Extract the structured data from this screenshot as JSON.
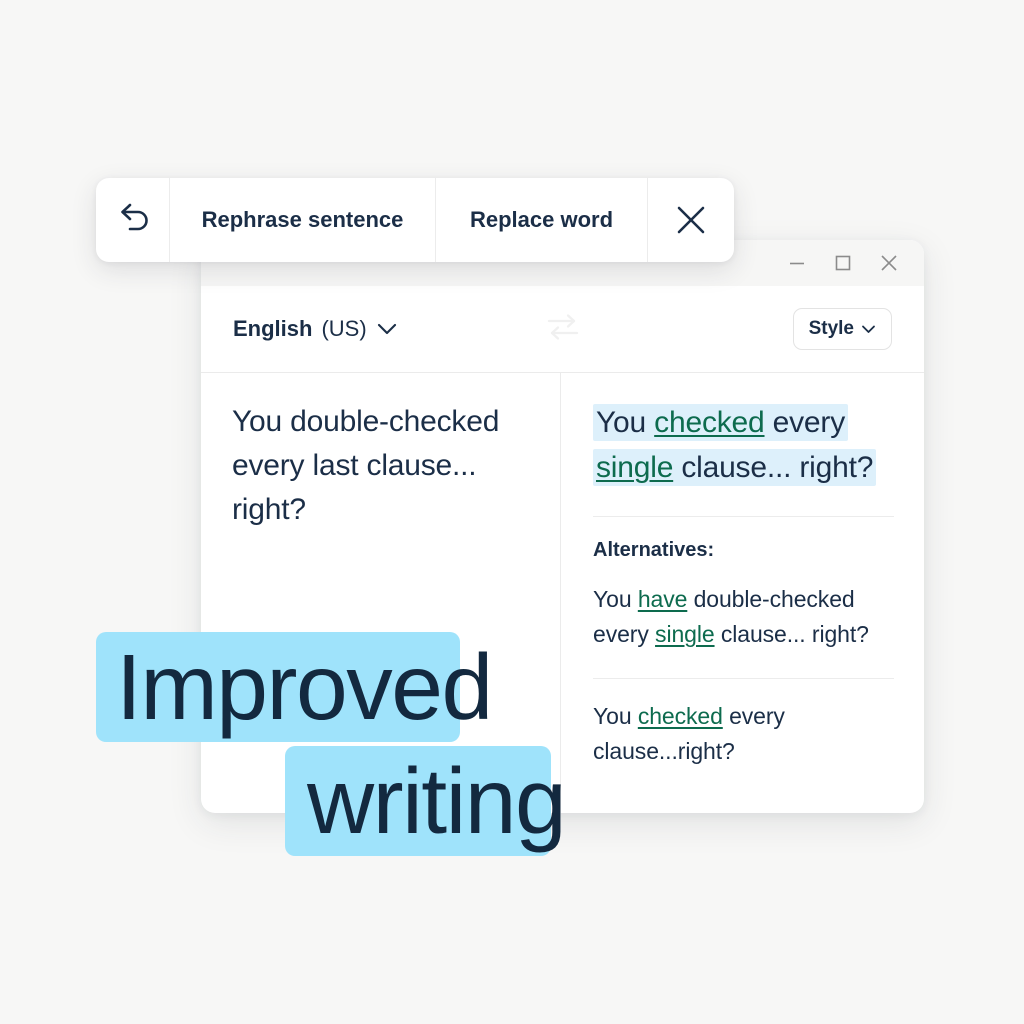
{
  "theme": {
    "page_background": "#f7f7f6",
    "text_primary": "#1b2e47",
    "accent_green": "#0d6b4e",
    "result_highlight": "#ddf0fb",
    "headline_highlight": "#9fe3fb",
    "divider": "#ececec"
  },
  "action_bar": {
    "undo_icon": "undo-arrow-icon",
    "rephrase_label": "Rephrase sentence",
    "replace_label": "Replace word",
    "close_icon": "close-icon"
  },
  "window": {
    "controls": {
      "minimize": "minimize-icon",
      "maximize": "maximize-icon",
      "close": "close-icon"
    },
    "options_bar": {
      "language_name": "English",
      "language_region": "(US)",
      "language_chevron": "chevron-down-icon",
      "swap_icon": "swap-languages-icon",
      "style_label": "Style",
      "style_chevron": "chevron-down-icon"
    },
    "source_panel": {
      "text": "You double-checked every last clause... right?"
    },
    "result_panel": {
      "prefix": "You ",
      "change_1": "checked",
      "middle": " every ",
      "change_2": "single",
      "suffix": " clause... right?",
      "alternatives_heading": "Alternatives:",
      "alternatives": [
        {
          "part_1": "You ",
          "change_1": "have",
          "part_2": " double-checked every ",
          "change_2": "single",
          "part_3": " clause... right?"
        },
        {
          "part_1": "You ",
          "change_1": "checked",
          "part_2": " every clause...right?",
          "change_2": "",
          "part_3": ""
        }
      ]
    }
  },
  "headline": {
    "word_1": "Improved",
    "word_2": "writing"
  }
}
